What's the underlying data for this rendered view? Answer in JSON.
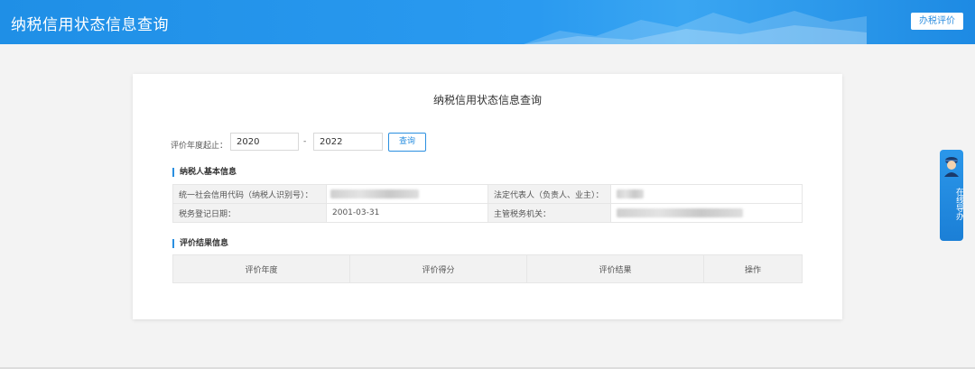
{
  "header": {
    "title": "纳税信用状态信息查询",
    "action_button": "办税评价"
  },
  "card": {
    "title": "纳税信用状态信息查询"
  },
  "filter": {
    "label": "评价年度起止：",
    "year_from": "2020",
    "separator": "-",
    "year_to": "2022",
    "query_button": "查询"
  },
  "basic_info": {
    "section_title": "纳税人基本信息",
    "credit_code_label": "统一社会信用代码（纳税人识别号）：",
    "legal_rep_label": "法定代表人（负责人、业主）：",
    "reg_date_label": "税务登记日期：",
    "reg_date_value": "2001-03-31",
    "tax_office_label": "主管税务机关："
  },
  "result": {
    "section_title": "评价结果信息",
    "columns": [
      "评价年度",
      "评价得分",
      "评价结果",
      "操作"
    ]
  },
  "side_helper": {
    "text": "在线导办"
  },
  "colors": {
    "header_blue": "#1f8fe6",
    "accent_blue": "#2a8fe0",
    "page_bg": "#f3f3f3"
  }
}
